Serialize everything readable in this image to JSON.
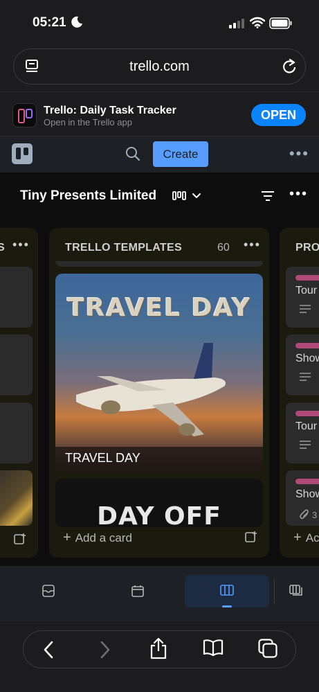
{
  "status_bar": {
    "time": "05:21"
  },
  "browser": {
    "url": "trello.com"
  },
  "app_banner": {
    "title": "Trello: Daily Task Tracker",
    "subtitle": "Open in the Trello app",
    "open_label": "OPEN"
  },
  "header": {
    "create_label": "Create"
  },
  "board": {
    "title": "Tiny Presents Limited",
    "lists": [
      {
        "title": "S",
        "position": "left-partial"
      },
      {
        "title": "TRELLO TEMPLATES",
        "count": "60",
        "cards": [
          {
            "title": "TRAVEL DAY",
            "cover_text": "TRAVEL DAY"
          },
          {
            "title": "DAY OFF",
            "cover_text": "DAY OFF"
          }
        ],
        "add_card_label": "Add a card"
      },
      {
        "title": "PRO",
        "cards": [
          {
            "title": "Tour"
          },
          {
            "title": "Show"
          },
          {
            "title": "Tour"
          },
          {
            "title": "Show",
            "attachments": "3"
          }
        ],
        "add_card_label": "Ac"
      }
    ]
  },
  "view_tabs": [
    {
      "name": "inbox",
      "active": false
    },
    {
      "name": "planner",
      "active": false
    },
    {
      "name": "board",
      "active": true
    },
    {
      "name": "switch-boards",
      "active": false
    }
  ],
  "colors": {
    "accent": "#579dff",
    "open_button": "#0a84ff",
    "label_pink": "#b0487a",
    "list_bg": "#1a1b0e"
  }
}
